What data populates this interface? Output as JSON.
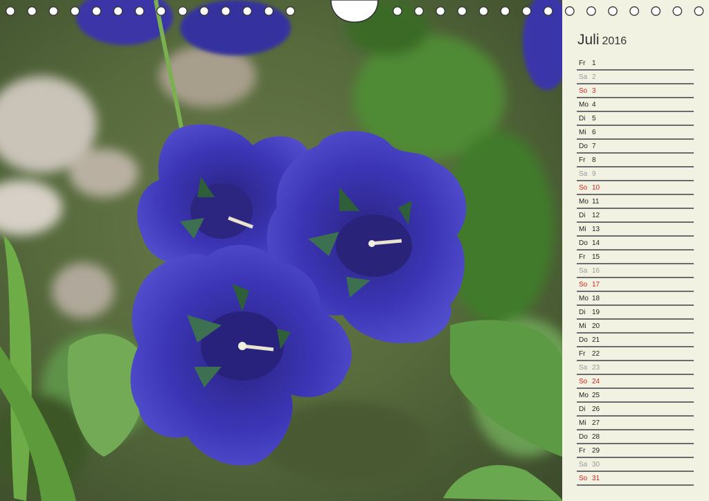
{
  "calendar": {
    "month": "Juli",
    "year": "2016",
    "days": [
      {
        "wd": "Fr",
        "d": "1",
        "type": "weekday"
      },
      {
        "wd": "Sa",
        "d": "2",
        "type": "sat"
      },
      {
        "wd": "So",
        "d": "3",
        "type": "sun"
      },
      {
        "wd": "Mo",
        "d": "4",
        "type": "weekday"
      },
      {
        "wd": "Di",
        "d": "5",
        "type": "weekday"
      },
      {
        "wd": "Mi",
        "d": "6",
        "type": "weekday"
      },
      {
        "wd": "Do",
        "d": "7",
        "type": "weekday"
      },
      {
        "wd": "Fr",
        "d": "8",
        "type": "weekday"
      },
      {
        "wd": "Sa",
        "d": "9",
        "type": "sat"
      },
      {
        "wd": "So",
        "d": "10",
        "type": "sun"
      },
      {
        "wd": "Mo",
        "d": "11",
        "type": "weekday"
      },
      {
        "wd": "Di",
        "d": "12",
        "type": "weekday"
      },
      {
        "wd": "Mi",
        "d": "13",
        "type": "weekday"
      },
      {
        "wd": "Do",
        "d": "14",
        "type": "weekday"
      },
      {
        "wd": "Fr",
        "d": "15",
        "type": "weekday"
      },
      {
        "wd": "Sa",
        "d": "16",
        "type": "sat"
      },
      {
        "wd": "So",
        "d": "17",
        "type": "sun"
      },
      {
        "wd": "Mo",
        "d": "18",
        "type": "weekday"
      },
      {
        "wd": "Di",
        "d": "19",
        "type": "weekday"
      },
      {
        "wd": "Mi",
        "d": "20",
        "type": "weekday"
      },
      {
        "wd": "Do",
        "d": "21",
        "type": "weekday"
      },
      {
        "wd": "Fr",
        "d": "22",
        "type": "weekday"
      },
      {
        "wd": "Sa",
        "d": "23",
        "type": "sat"
      },
      {
        "wd": "So",
        "d": "24",
        "type": "sun"
      },
      {
        "wd": "Mo",
        "d": "25",
        "type": "weekday"
      },
      {
        "wd": "Di",
        "d": "26",
        "type": "weekday"
      },
      {
        "wd": "Mi",
        "d": "27",
        "type": "weekday"
      },
      {
        "wd": "Do",
        "d": "28",
        "type": "weekday"
      },
      {
        "wd": "Fr",
        "d": "29",
        "type": "weekday"
      },
      {
        "wd": "Sa",
        "d": "30",
        "type": "sat"
      },
      {
        "wd": "So",
        "d": "31",
        "type": "sun"
      }
    ]
  },
  "colors": {
    "panel_background": "#f2f2e2",
    "sunday_red": "#d42020",
    "saturday_grey": "#999999",
    "flower_blue": "#3b35b5",
    "foliage_green": "#4d8a3c"
  },
  "photo": {
    "icon": "gentian-flower-photo"
  }
}
